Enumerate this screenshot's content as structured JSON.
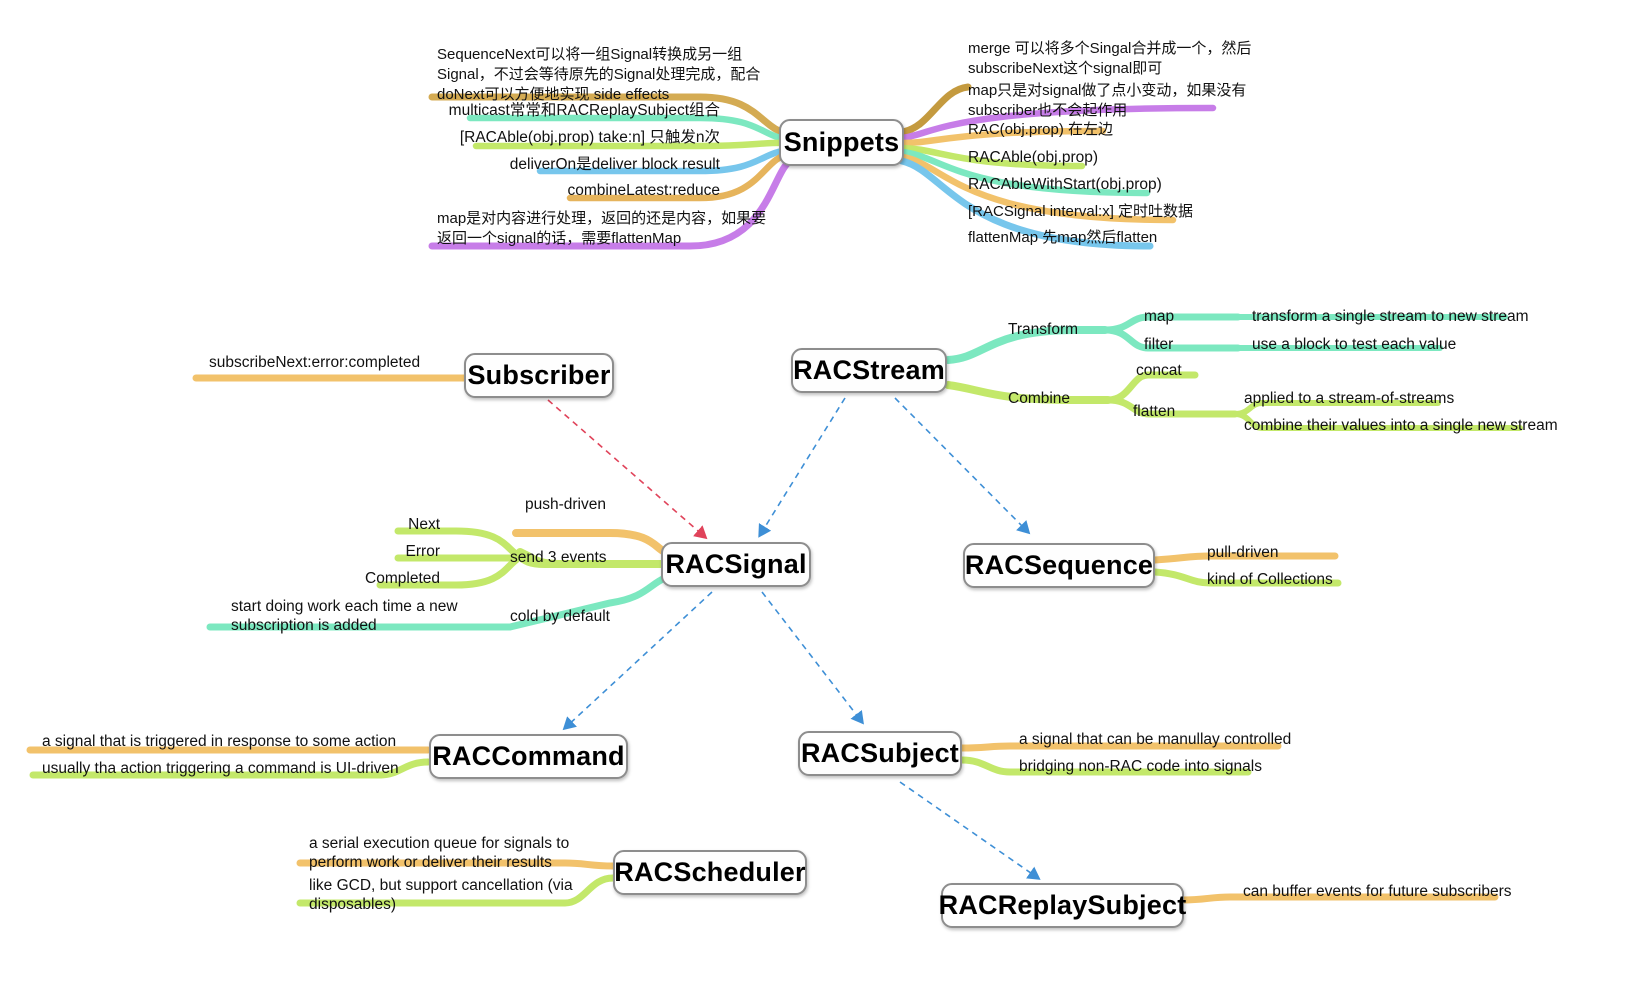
{
  "title": "ReactiveCocoa mind map",
  "nodes": {
    "snippets": "Snippets",
    "subscriber": "Subscriber",
    "racstream": "RACStream",
    "racsignal": "RACSignal",
    "racsequence": "RACSequence",
    "raccommand": "RACCommand",
    "racsubject": "RACSubject",
    "racscheduler": "RACScheduler",
    "racreplaysubject": "RACReplaySubject"
  },
  "snippets_left": [
    "SequenceNext可以将一组Signal转换成另一组\nSignal，不过会等待原先的Signal处理完成，配合\ndoNext可以方便地实现 side effects",
    "multicast常常和RACReplaySubject组合",
    "[RACAble(obj.prop) take:n] 只触发n次",
    "deliverOn是deliver block result",
    "combineLatest:reduce",
    "map是对内容进行处理，返回的还是内容，如果要\n返回一个signal的话，需要flattenMap"
  ],
  "snippets_right": [
    "merge 可以将多个Singal合并成一个，然后\nsubscribeNext这个signal即可",
    "map只是对signal做了点小变动，如果没有\nsubscriber也不会起作用",
    "RAC(obj.prop) 在左边",
    "RACAble(obj.prop)",
    "RACAbleWithStart(obj.prop)",
    "[RACSignal interval:x] 定时吐数据",
    "flattenMap 先map然后flatten"
  ],
  "subscriber_branch": [
    "subscribeNext:error:completed"
  ],
  "racstream_branches": [
    {
      "label": "Transform",
      "children": [
        {
          "label": "map",
          "desc": "transform a single stream to new stream"
        },
        {
          "label": "filter",
          "desc": "use a block to test each value"
        }
      ]
    },
    {
      "label": "Combine",
      "children": [
        {
          "label": "concat",
          "desc": ""
        },
        {
          "label": "flatten",
          "desc": "applied to a stream-of-streams"
        },
        {
          "label": "",
          "desc": "combine their values into a single new stream"
        }
      ]
    }
  ],
  "racsignal_branches": {
    "push_driven": "push-driven",
    "send_3_events": "send 3 events",
    "events": [
      "Next",
      "Error",
      "Completed"
    ],
    "cold_by_default": "cold by default",
    "cold_desc": "start doing work each time a new\nsubscription is added"
  },
  "racsequence_branches": [
    "pull-driven",
    "kind of Collections"
  ],
  "raccommand_branches": [
    "a signal that is triggered in response to some action",
    "usually tha action triggering a command is UI-driven"
  ],
  "racsubject_branches": [
    "a signal that can be manullay controlled",
    "bridging non-RAC code into signals"
  ],
  "racscheduler_branches": [
    "a serial execution queue for signals to\nperform work or deliver their results",
    "like GCD, but support cancellation (via\ndisposables)"
  ],
  "racreplaysubject_branches": [
    "can buffer events for future subscribers"
  ],
  "colors": {
    "orange": "#F2C26B",
    "gold": "#D4AB53",
    "green": "#C3E86A",
    "mint": "#7CE8C0",
    "teal": "#6FE8C8",
    "blue": "#77C6EC",
    "purple": "#C77DE8",
    "node_border": "#8d8d8d",
    "dashed_blue": "#3E8FD6",
    "dashed_red": "#E0435A"
  }
}
